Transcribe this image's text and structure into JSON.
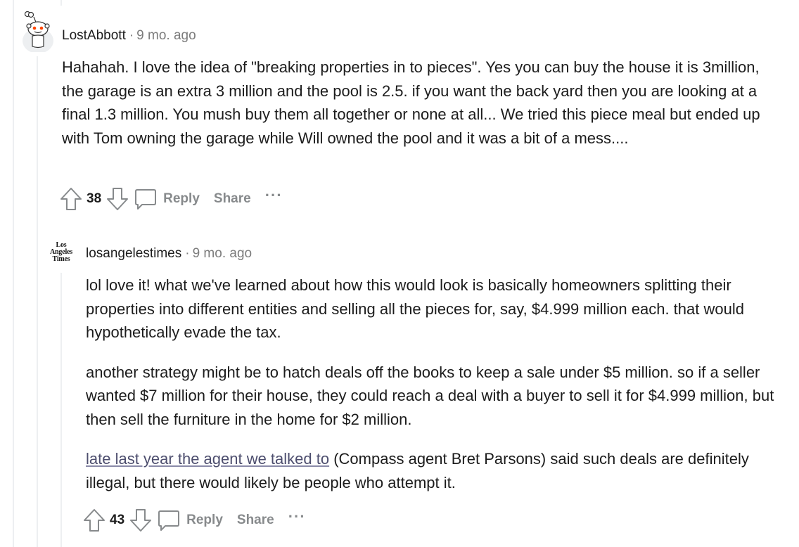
{
  "comments": [
    {
      "author": "LostAbbott",
      "time": "9 mo. ago",
      "avatar_icon": "snoo-avatar-icon",
      "paragraphs": [
        "Hahahah. I love the idea of \"breaking properties in to pieces\". Yes you can buy the house it is 3million, the garage is an extra 3 million and the pool is 2.5. if you want the back yard then you are looking at a final 1.3 million. You mush buy them all together or none at all... We tried this piece meal but ended up with Tom owning the garage while Will owned the pool and it was a bit of a mess...."
      ],
      "votes": "38",
      "reply_label": "Reply",
      "share_label": "Share",
      "more_label": "···"
    },
    {
      "author": "losangelestimes",
      "time": "9 mo. ago",
      "avatar_text": [
        "Los",
        "Angeles",
        "Times"
      ],
      "paragraphs": [
        "lol love it! what we've learned about how this would look is basically homeowners splitting their properties into different entities and selling all the pieces for, say, $4.999 million each. that would hypothetically evade the tax.",
        "another strategy might be to hatch deals off the books to keep a sale under $5 million. so if a seller wanted $7 million for their house, they could reach a deal with a buyer to sell it for $4.999 million, but then sell the furniture in the home for $2 million."
      ],
      "link_text": "late last year the agent we talked to",
      "link_after": " (Compass agent Bret Parsons) said such deals are definitely illegal, but there would likely be people who attempt it.",
      "votes": "43",
      "reply_label": "Reply",
      "share_label": "Share",
      "more_label": "···"
    }
  ],
  "colors": {
    "thread_line": "#edeff1",
    "meta_gray": "#7c7c7c",
    "action_gray": "#878a8c",
    "link": "#4d4e6e",
    "avatar_accent": "#ff4500"
  }
}
